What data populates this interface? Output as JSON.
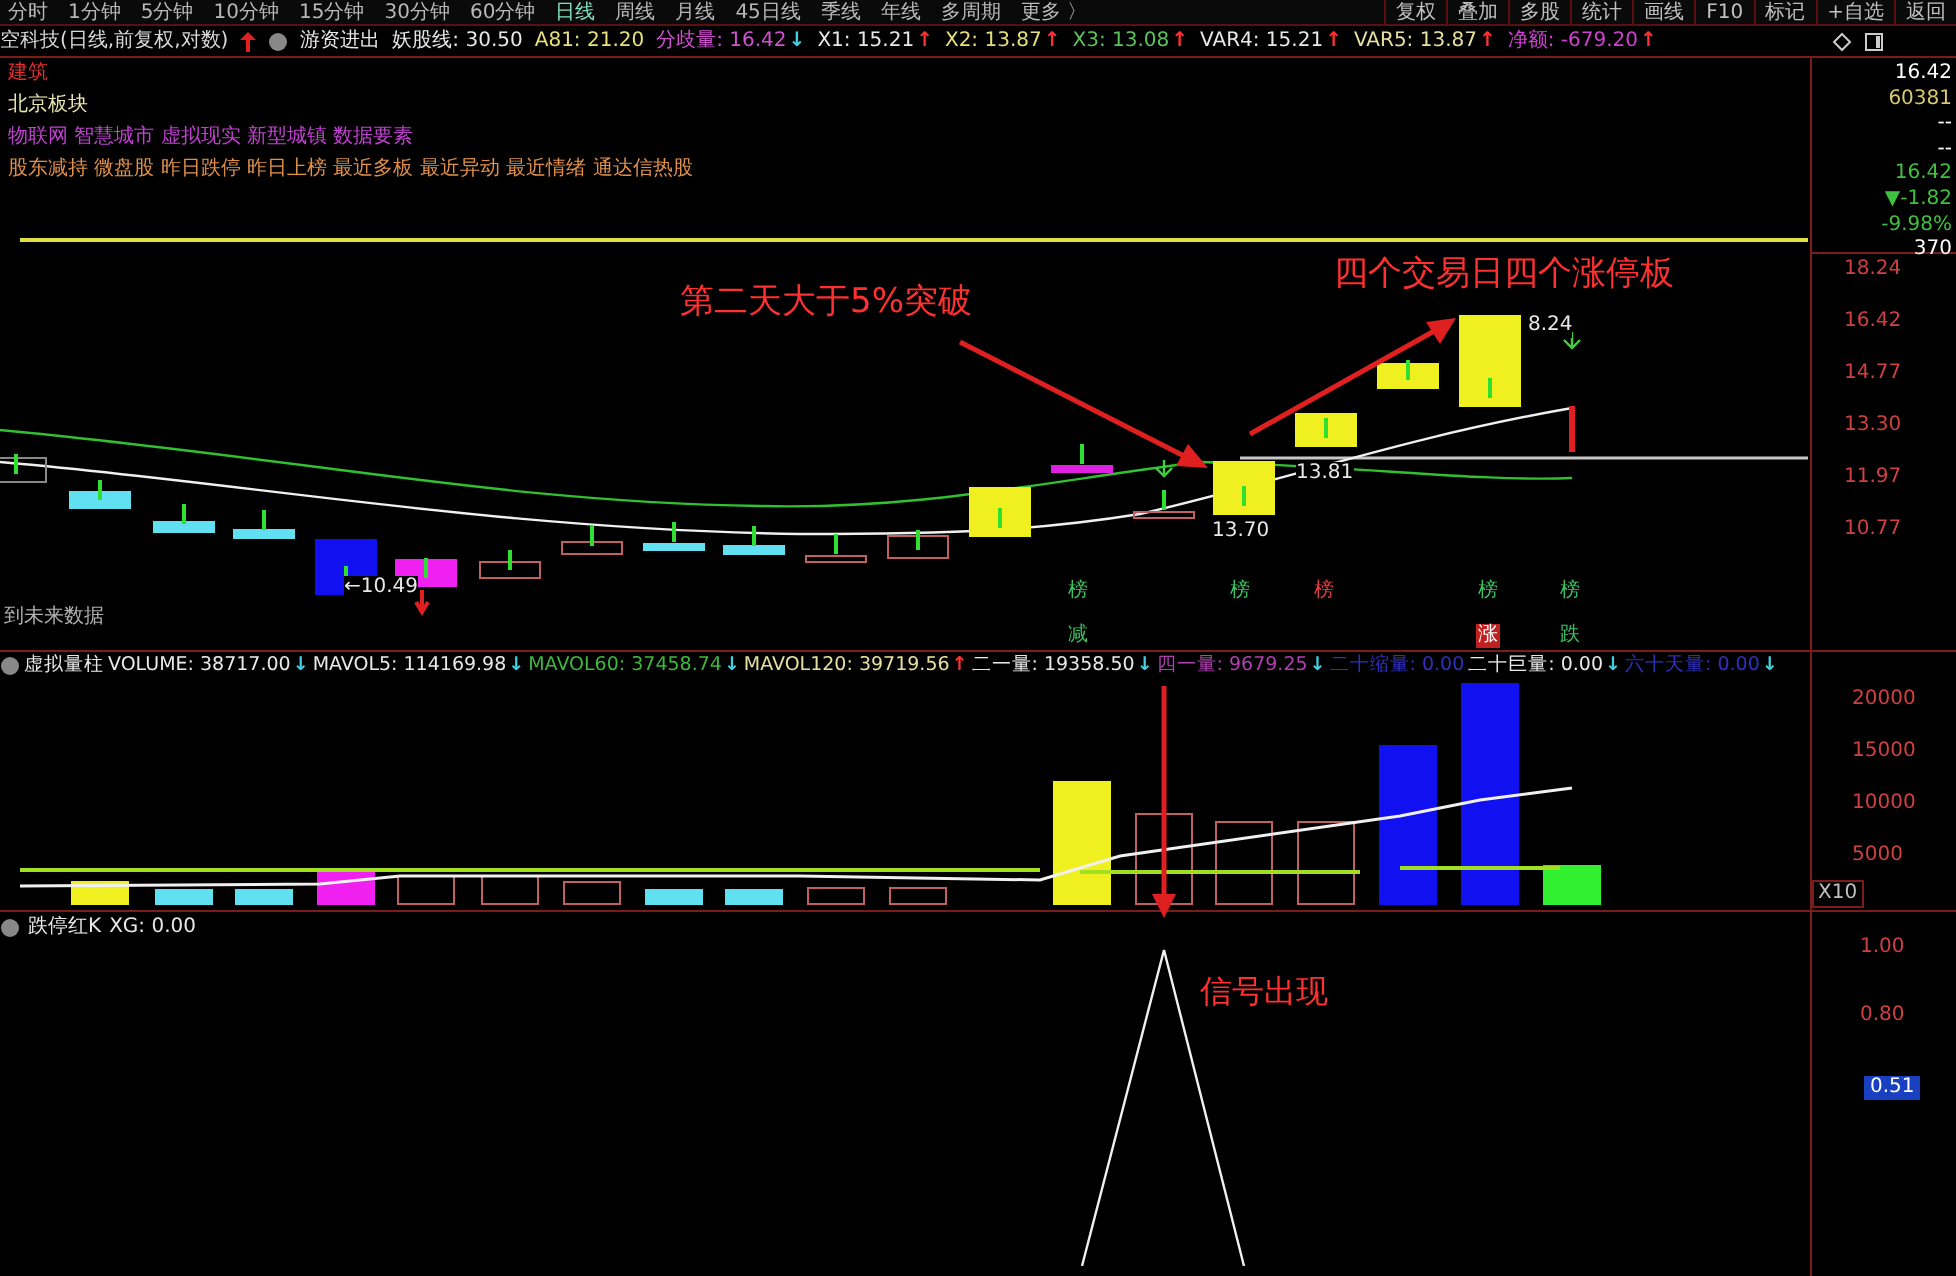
{
  "period_tabs": [
    {
      "label": "分时",
      "selected": false
    },
    {
      "label": "1分钟",
      "selected": false
    },
    {
      "label": "5分钟",
      "selected": false
    },
    {
      "label": "10分钟",
      "selected": false
    },
    {
      "label": "15分钟",
      "selected": false
    },
    {
      "label": "30分钟",
      "selected": false
    },
    {
      "label": "60分钟",
      "selected": false
    },
    {
      "label": "日线",
      "selected": true
    },
    {
      "label": "周线",
      "selected": false
    },
    {
      "label": "月线",
      "selected": false
    },
    {
      "label": "45日线",
      "selected": false
    },
    {
      "label": "季线",
      "selected": false
    },
    {
      "label": "年线",
      "selected": false
    },
    {
      "label": "多周期",
      "selected": false
    },
    {
      "label": "更多 〉",
      "selected": false
    }
  ],
  "toolbar_buttons": [
    "复权",
    "叠加",
    "多股",
    "统计",
    "画线",
    "F10",
    "标记",
    "+自选",
    "返回"
  ],
  "main_legend": {
    "title": "空科技(日线,前复权,对数)",
    "indicator": "游资进出",
    "items": [
      {
        "text": "妖股线: 30.50",
        "color": "#e8e8e8"
      },
      {
        "text": "A81: 21.20",
        "color": "#e6e07a"
      },
      {
        "text": "分歧量: 16.42",
        "color": "#d050d0",
        "arrow": "↓",
        "rising": false
      },
      {
        "text": "X1: 15.21",
        "color": "#e8e8e8",
        "arrow": "↑",
        "rising": true
      },
      {
        "text": "X2: 13.87",
        "color": "#e6e07a",
        "arrow": "↑",
        "rising": true
      },
      {
        "text": "X3: 13.08",
        "color": "#5cc45c",
        "arrow": "↑",
        "rising": true
      },
      {
        "text": "VAR4: 15.21",
        "color": "#e8e8e8",
        "arrow": "↑",
        "rising": true
      },
      {
        "text": "VAR5: 13.87",
        "color": "#e6e0a0",
        "arrow": "↑",
        "rising": true
      },
      {
        "text": "净额: -679.20",
        "color": "#d040d0",
        "arrow": "↑",
        "rising": true
      }
    ]
  },
  "sector_lines": [
    {
      "text": "建筑",
      "color": "#e03030"
    },
    {
      "text": "北京板块",
      "color": "#e8e8b0"
    },
    {
      "text": "物联网 智慧城市 虚拟现实 新型城镇 数据要素",
      "color": "#c040d0"
    },
    {
      "text": "股东减持 微盘股 昨日跌停 昨日上榜 最近多板 最近异动 最近情绪 通达信热股",
      "color": "#e0904a"
    }
  ],
  "main_chart": {
    "annotations": [
      "第二天大于5%突破",
      "四个交易日四个涨停板"
    ],
    "price_labels": [
      "←10.49",
      "13.70",
      "13.81",
      "8.24"
    ],
    "note": "到未来数据",
    "markers": [
      {
        "text": "榜",
        "color": "#3cc060",
        "kind": "text"
      },
      {
        "text": "榜",
        "color": "#3cc060",
        "kind": "text"
      },
      {
        "text": "榜",
        "color": "#e04040",
        "kind": "text"
      },
      {
        "text": "榜",
        "color": "#3cc060",
        "kind": "text"
      },
      {
        "text": "榜",
        "color": "#3cc060",
        "kind": "text"
      },
      {
        "text": "减",
        "color": "#3cc060",
        "kind": "text"
      },
      {
        "text": "涨",
        "color": "#c02020",
        "kind": "badge"
      },
      {
        "text": "跌",
        "color": "#3cc060",
        "kind": "text"
      }
    ]
  },
  "quote_panel": [
    {
      "text": "16.42",
      "color": "#ffffff"
    },
    {
      "text": "60381",
      "color": "#d8c870"
    },
    {
      "text": "--",
      "color": "#ffffff"
    },
    {
      "text": "--",
      "color": "#ffffff"
    },
    {
      "text": "16.42",
      "color": "#40c040"
    },
    {
      "text": "▼-1.82",
      "color": "#40c040"
    },
    {
      "text": "-9.98%",
      "color": "#40c040"
    },
    {
      "text": "370",
      "color": "#ffffff"
    }
  ],
  "price_axis": [
    "18.24",
    "16.42",
    "14.77",
    "13.30",
    "11.97",
    "10.77"
  ],
  "volume_legend": {
    "title": "虚拟量柱",
    "items": [
      {
        "text": "VOLUME: 38717.00",
        "color": "#e8e8e8",
        "arrow": "↓",
        "rising": false
      },
      {
        "text": "MAVOL5: 114169.98",
        "color": "#e8e8e8",
        "arrow": "↓",
        "rising": false
      },
      {
        "text": "MAVOL60: 37458.74",
        "color": "#3cb83c",
        "arrow": "↓",
        "rising": false
      },
      {
        "text": "MAVOL120: 39719.56",
        "color": "#e6e0a0",
        "arrow": "↑",
        "rising": true
      },
      {
        "text": "二一量: 19358.50",
        "color": "#e8e8e8",
        "arrow": "↓",
        "rising": false
      },
      {
        "text": "四一量: 9679.25",
        "color": "#b040b0",
        "arrow": "↓",
        "rising": false
      },
      {
        "text": "二十缩量: 0.00",
        "color": "#3030c0"
      },
      {
        "text": "二十巨量: 0.00",
        "color": "#e8e8e8",
        "arrow": "↓",
        "rising": false
      },
      {
        "text": "六十天量: 0.00",
        "color": "#3030c0",
        "arrow": "↓",
        "rising": false
      }
    ]
  },
  "volume_axis": [
    "20000",
    "15000",
    "10000",
    "5000"
  ],
  "volume_scale": "X10",
  "signal_legend": {
    "title": "跌停红K",
    "text": "XG: 0.00"
  },
  "signal_annotation": "信号出现",
  "signal_axis": [
    "1.00",
    "0.80"
  ],
  "signal_current": "0.51"
}
